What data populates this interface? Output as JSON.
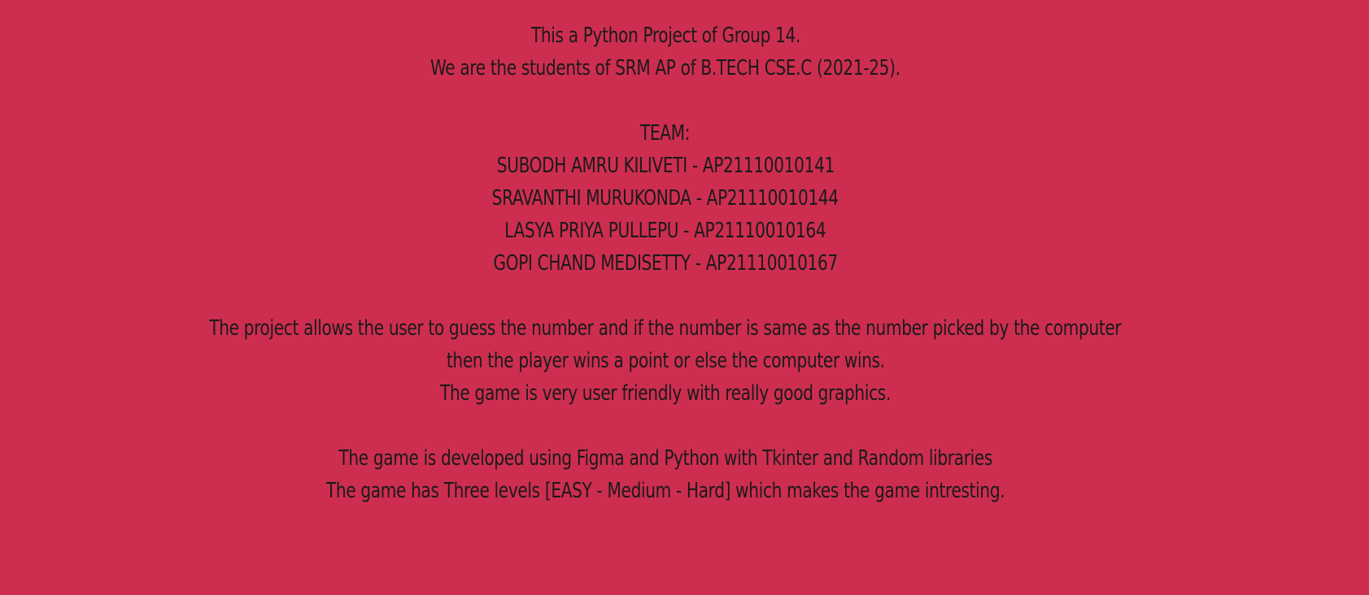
{
  "colors": {
    "background": "#CD2E50",
    "text": "#1a1a1a"
  },
  "intro": {
    "line1": "This a Python Project of Group 14.",
    "line2": "We are the students of SRM AP of B.TECH CSE.C (2021-25)."
  },
  "team": {
    "heading": "TEAM:",
    "members": [
      "SUBODH AMRU KILIVETI - AP21110010141",
      "SRAVANTHI MURUKONDA - AP21110010144",
      "LASYA PRIYA PULLEPU - AP21110010164",
      "GOPI CHAND MEDISETTY - AP21110010167"
    ]
  },
  "description": {
    "line1": "The project allows the user to guess the number and if the number is same as the number picked by the computer",
    "line2": "then the player wins a point or else the computer wins.",
    "line3": "The game is very user friendly with really good graphics."
  },
  "details": {
    "line1": "The game is developed using Figma and Python with Tkinter and Random libraries",
    "line2": "The game has Three levels [EASY - Medium - Hard] which makes the game intresting."
  }
}
